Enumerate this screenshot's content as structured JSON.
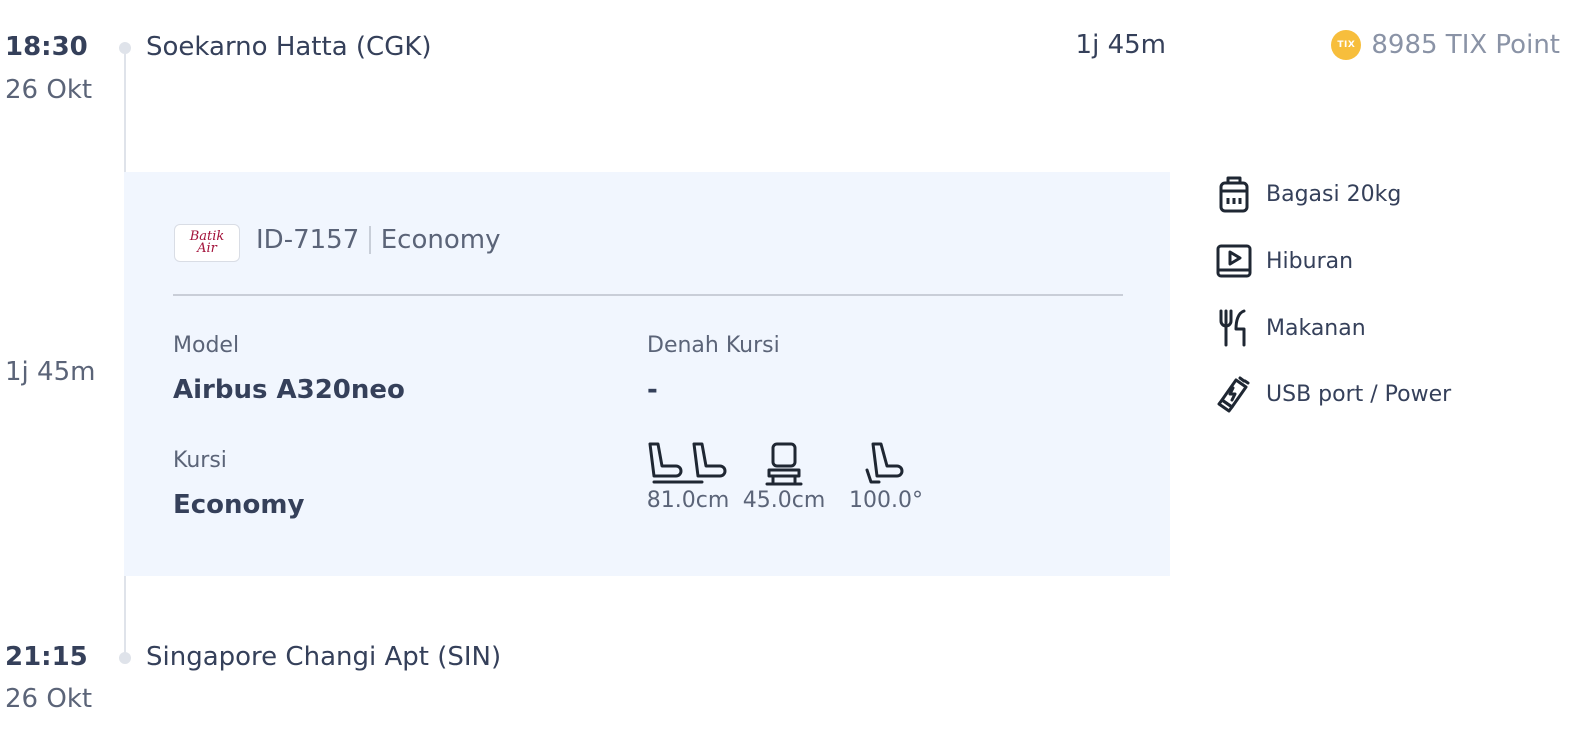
{
  "departure": {
    "time": "18:30",
    "date": "26 Okt",
    "airport": "Soekarno Hatta (CGK)"
  },
  "arrival": {
    "time": "21:15",
    "date": "26 Okt",
    "airport": "Singapore Changi Apt (SIN)"
  },
  "duration_top": "1j 45m",
  "duration_side": "1j 45m",
  "tix_point": {
    "coin": "TIX",
    "label": "8985 TIX Point"
  },
  "flight": {
    "logo_text": "Batik Air",
    "number": "ID-7157",
    "cabin": "Economy",
    "model_label": "Model",
    "model_value": "Airbus A320neo",
    "seatmap_label": "Denah Kursi",
    "seatmap_value": "-",
    "seat_label": "Kursi",
    "seat_value": "Economy",
    "seat_pitch": "81.0cm",
    "seat_width": "45.0cm",
    "seat_recline": "100.0°"
  },
  "amenities": [
    {
      "icon": "luggage-icon",
      "label": "Bagasi 20kg"
    },
    {
      "icon": "entertainment-icon",
      "label": "Hiburan"
    },
    {
      "icon": "meal-icon",
      "label": "Makanan"
    },
    {
      "icon": "usb-power-icon",
      "label": "USB port / Power"
    }
  ],
  "colors": {
    "accent_coin": "#f7be3c",
    "card_bg": "#f1f6fe",
    "text_primary": "#35405a",
    "text_secondary": "#5b6478"
  }
}
